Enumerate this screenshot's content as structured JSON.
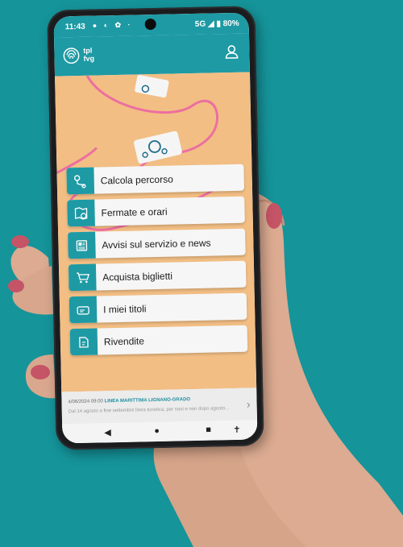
{
  "status_bar": {
    "time": "11:43",
    "left_icons": "● ◐ ✿ ·",
    "right": "5G ◢ ▮ 80%"
  },
  "app_bar": {
    "brand_line1": "tpl",
    "brand_line2": "fvg",
    "logo_icon": "fingerprint-icon",
    "profile_icon": "user-icon"
  },
  "menu": {
    "items": [
      {
        "label": "Calcola percorso",
        "icon": "route-pin-icon"
      },
      {
        "label": "Fermate e orari",
        "icon": "map-clock-icon"
      },
      {
        "label": "Avvisi sul servizio e news",
        "icon": "newspaper-icon"
      },
      {
        "label": "Acquista biglietti",
        "icon": "cart-icon"
      },
      {
        "label": "I miei titoli",
        "icon": "ticket-icon"
      },
      {
        "label": "Rivendite",
        "icon": "store-ticket-icon"
      }
    ]
  },
  "news_banner": {
    "date": "4/06/2024 09:00",
    "title": "LINEA MARITTIMA LIGNANO-GRADO",
    "subtitle": "Dal 14 agosto a fine settembre linea turistica, per navi e non dopo agosto..."
  },
  "nav_bar": {
    "back": "◀",
    "home": "●",
    "recents": "■",
    "accessibility": "✝"
  },
  "colors": {
    "brand": "#1e9aa4",
    "background": "#15949a",
    "hero": "#f2be84"
  }
}
